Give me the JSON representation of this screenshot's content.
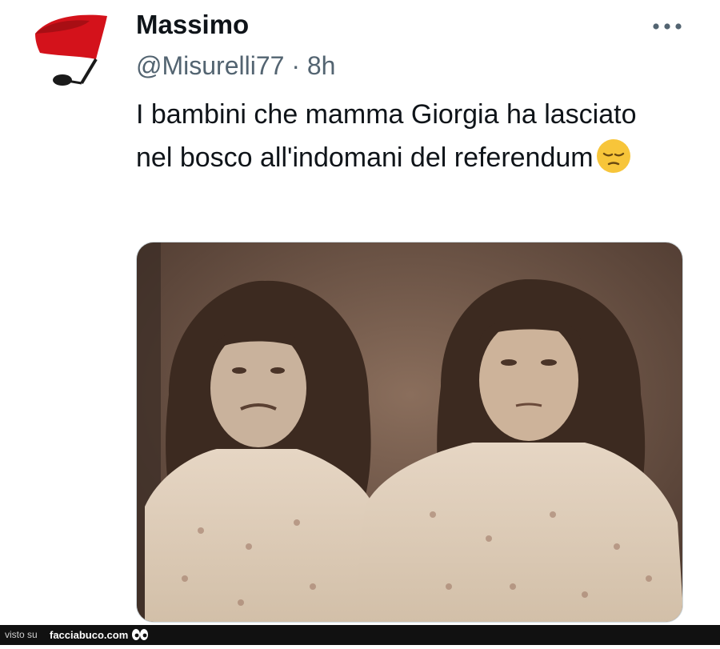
{
  "tweet": {
    "author_name": "Massimo",
    "handle_time": "@Misurelli77 · 8h",
    "text": "I bambini che mamma Giorgia ha lasciato nel bosco all'indomani del referendum",
    "emoji": "pensive-face-emoji",
    "media_description_icon": "sepia-photo-two-children"
  },
  "footer": {
    "visto_su": "visto su",
    "brand": "facciabuco.com"
  },
  "colors": {
    "text": "#0f1419",
    "secondary": "#536471",
    "footer_bg": "#111111",
    "avatar_red": "#d4121b"
  }
}
